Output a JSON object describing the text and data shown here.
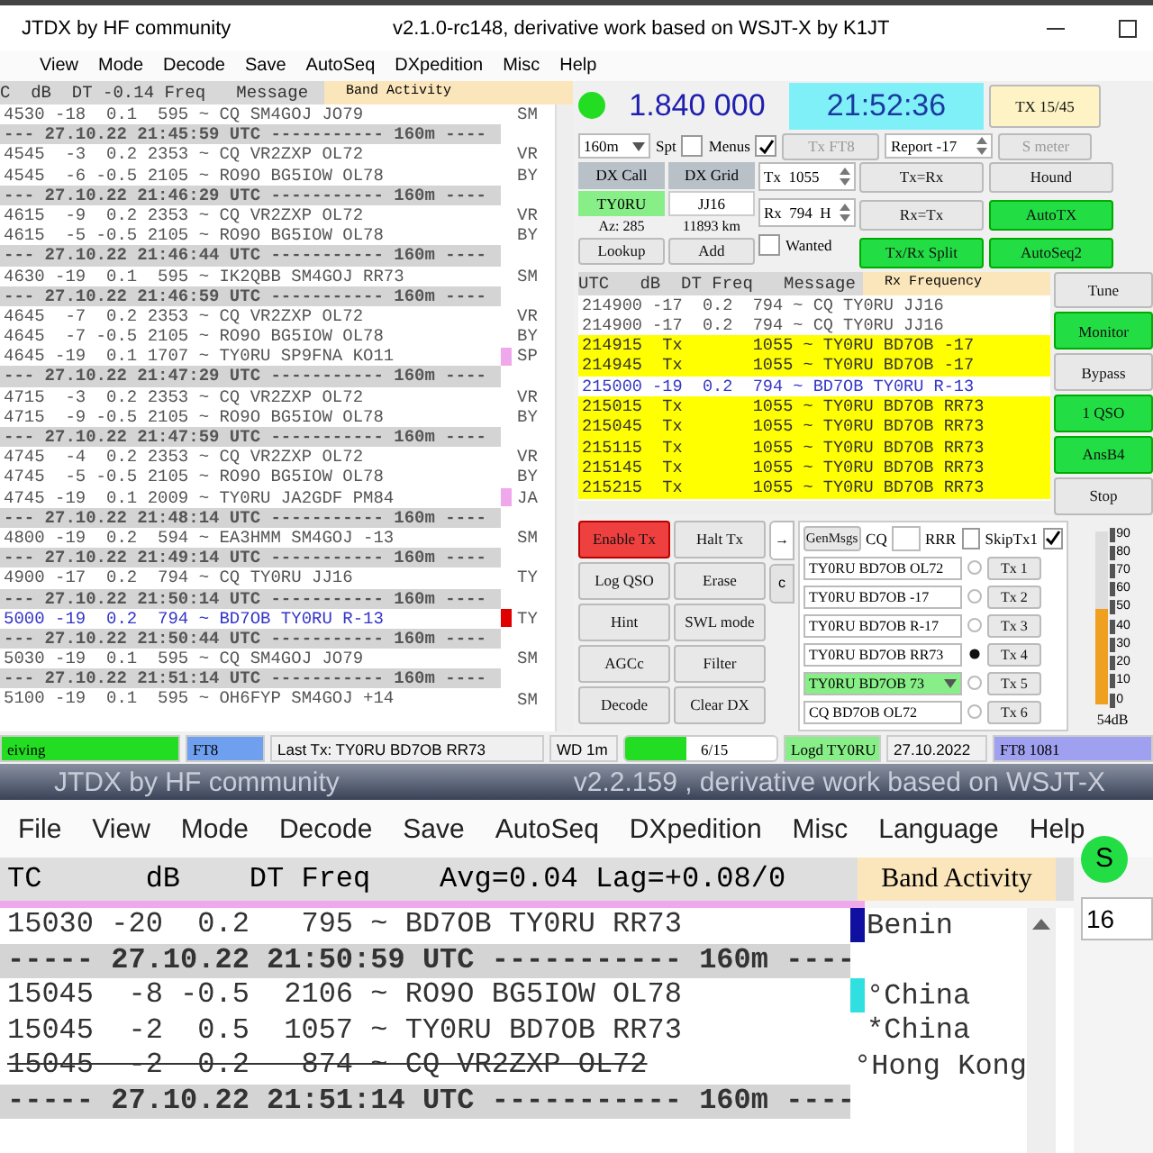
{
  "window": {
    "title": "JTDX  by HF community",
    "subtitle": "v2.1.0-rc148, derivative work based on WSJT-X by K1JT"
  },
  "menu": [
    "View",
    "Mode",
    "Decode",
    "Save",
    "AutoSeq",
    "DXpedition",
    "Misc",
    "Help"
  ],
  "band_activity": {
    "header": "C  dB  DT -0.14 Freq   Message",
    "tab": "Band Activity",
    "rows": [
      {
        "kind": "decode",
        "text": "4530 -18  0.1  595 ~ CQ SM4GOJ JO79",
        "country": "SM"
      },
      {
        "kind": "separator",
        "text": "--- 27.10.22 21:45:59 UTC ----------- 160m ----"
      },
      {
        "kind": "decode",
        "text": "4545  -3  0.2 2353 ~ CQ VR2ZXP OL72",
        "country": "VR"
      },
      {
        "kind": "decode",
        "text": "4545  -6 -0.5 2105 ~ RO9O BG5IOW OL78",
        "country": "BY"
      },
      {
        "kind": "separator",
        "text": "--- 27.10.22 21:46:29 UTC ----------- 160m ----"
      },
      {
        "kind": "decode",
        "text": "4615  -9  0.2 2353 ~ CQ VR2ZXP OL72",
        "country": "VR"
      },
      {
        "kind": "decode",
        "text": "4615  -5 -0.5 2105 ~ RO9O BG5IOW OL78",
        "country": "BY"
      },
      {
        "kind": "separator",
        "text": "--- 27.10.22 21:46:44 UTC ----------- 160m ----"
      },
      {
        "kind": "decode",
        "text": "4630 -19  0.1  595 ~ IK2QBB SM4GOJ RR73",
        "country": "SM"
      },
      {
        "kind": "separator",
        "text": "--- 27.10.22 21:46:59 UTC ----------- 160m ----"
      },
      {
        "kind": "decode",
        "text": "4645  -7  0.2 2353 ~ CQ VR2ZXP OL72",
        "country": "VR"
      },
      {
        "kind": "decode",
        "text": "4645  -7 -0.5 2105 ~ RO9O BG5IOW OL78",
        "country": "BY"
      },
      {
        "kind": "decode",
        "text": "4645 -19  0.1 1707 ~ TY0RU SP9FNA KO11",
        "country": "SP",
        "color": "#f0a8ec"
      },
      {
        "kind": "separator",
        "text": "--- 27.10.22 21:47:29 UTC ----------- 160m ----"
      },
      {
        "kind": "decode",
        "text": "4715  -3  0.2 2353 ~ CQ VR2ZXP OL72",
        "country": "VR"
      },
      {
        "kind": "decode",
        "text": "4715  -9 -0.5 2105 ~ RO9O BG5IOW OL78",
        "country": "BY"
      },
      {
        "kind": "separator",
        "text": "--- 27.10.22 21:47:59 UTC ----------- 160m ----"
      },
      {
        "kind": "decode",
        "text": "4745  -4  0.2 2353 ~ CQ VR2ZXP OL72",
        "country": "VR"
      },
      {
        "kind": "decode",
        "text": "4745  -5 -0.5 2105 ~ RO9O BG5IOW OL78",
        "country": "BY"
      },
      {
        "kind": "decode",
        "text": "4745 -19  0.1 2009 ~ TY0RU JA2GDF PM84",
        "country": "JA",
        "color": "#f0a8ec"
      },
      {
        "kind": "separator",
        "text": "--- 27.10.22 21:48:14 UTC ----------- 160m ----"
      },
      {
        "kind": "decode",
        "text": "4800 -19  0.2  594 ~ EA3HMM SM4GOJ -13",
        "country": "SM"
      },
      {
        "kind": "separator",
        "text": "--- 27.10.22 21:49:14 UTC ----------- 160m ----"
      },
      {
        "kind": "decode",
        "text": "4900 -17  0.2  794 ~ CQ TY0RU JJ16",
        "country": "TY"
      },
      {
        "kind": "separator",
        "text": "--- 27.10.22 21:50:14 UTC ----------- 160m ----"
      },
      {
        "kind": "decode",
        "text": "5000 -19  0.2  794 ~ BD7OB TY0RU R-13",
        "country": "TY",
        "color": "#e00000",
        "addressed": true
      },
      {
        "kind": "separator",
        "text": "--- 27.10.22 21:50:44 UTC ----------- 160m ----"
      },
      {
        "kind": "decode",
        "text": "5030 -19  0.1  595 ~ CQ SM4GOJ JO79",
        "country": "SM"
      },
      {
        "kind": "separator",
        "text": "--- 27.10.22 21:51:14 UTC ----------- 160m ----"
      },
      {
        "kind": "decode",
        "text": "5100 -19  0.1  595 ~ OH6FYP SM4GOJ +14",
        "country": "SM"
      }
    ]
  },
  "dial": {
    "led_on": true,
    "frequency": "1.840 000",
    "clock": "21:52:36",
    "tx_period": "TX 15/45"
  },
  "settings": {
    "band": "160m",
    "spt": {
      "label": "Spt",
      "checked": false
    },
    "menus": {
      "label": "Menus",
      "checked": true
    },
    "tx_mode": {
      "label": "Tx FT8",
      "disabled": true
    },
    "report": "Report -17",
    "s_meter": {
      "label": "S meter",
      "disabled": true
    }
  },
  "dx": {
    "call_label": "DX Call",
    "grid_label": "DX Grid",
    "call": "TY0RU",
    "grid": "JJ16",
    "azimuth": "Az: 285",
    "distance": "11893 km",
    "lookup": "Lookup",
    "add": "Add",
    "wanted": {
      "label": "Wanted",
      "checked": false
    }
  },
  "tx_freq": "Tx  1055",
  "rx_freq": "Rx  794  H",
  "toggles": [
    {
      "label": "Tx=Rx",
      "on": false
    },
    {
      "label": "Hound",
      "on": false
    },
    {
      "label": "Rx=Tx",
      "on": false
    },
    {
      "label": "AutoTX",
      "on": true
    },
    {
      "label": "Tx/Rx Split",
      "on": true
    },
    {
      "label": "AutoSeq2",
      "on": true
    }
  ],
  "rx_frequency": {
    "header": "UTC   dB  DT Freq   Message",
    "tab": "Rx Frequency",
    "rows": [
      {
        "kind": "rx",
        "text": "214900 -17  0.2  794 ~ CQ TY0RU JJ16"
      },
      {
        "kind": "rx",
        "text": "214900 -17  0.2  794 ~ CQ TY0RU JJ16"
      },
      {
        "kind": "tx",
        "text": "214915  Tx       1055 ~ TY0RU BD7OB -17"
      },
      {
        "kind": "tx",
        "text": "214945  Tx       1055 ~ TY0RU BD7OB -17"
      },
      {
        "kind": "rx",
        "text": "215000 -19  0.2  794 ~ BD7OB TY0RU R-13",
        "addressed": true
      },
      {
        "kind": "tx",
        "text": "215015  Tx       1055 ~ TY0RU BD7OB RR73"
      },
      {
        "kind": "tx",
        "text": "215045  Tx       1055 ~ TY0RU BD7OB RR73"
      },
      {
        "kind": "tx",
        "text": "215115  Tx       1055 ~ TY0RU BD7OB RR73"
      },
      {
        "kind": "tx",
        "text": "215145  Tx       1055 ~ TY0RU BD7OB RR73"
      },
      {
        "kind": "tx",
        "text": "215215  Tx       1055 ~ TY0RU BD7OB RR73"
      }
    ]
  },
  "side_buttons": [
    {
      "label": "Tune",
      "on": false
    },
    {
      "label": "Monitor",
      "on": true
    },
    {
      "label": "Bypass",
      "on": false
    },
    {
      "label": "1 QSO",
      "on": true
    },
    {
      "label": "AnsB4",
      "on": true
    },
    {
      "label": "Stop",
      "on": false
    }
  ],
  "action_buttons": [
    {
      "label": "Enable Tx",
      "on": true
    },
    {
      "label": "Halt Tx",
      "on": false
    },
    {
      "label": "Log QSO",
      "on": false
    },
    {
      "label": "Erase",
      "on": false
    },
    {
      "label": "Hint",
      "on": false
    },
    {
      "label": "SWL mode",
      "on": false
    },
    {
      "label": "AGCc",
      "on": false
    },
    {
      "label": "Filter",
      "on": false
    },
    {
      "label": "Decode",
      "on": false
    },
    {
      "label": "Clear DX",
      "on": false
    }
  ],
  "tabs": [
    {
      "label": "→",
      "selected": true
    },
    {
      "label": "c",
      "selected": false
    }
  ],
  "messages": {
    "gen": "GenMsgs",
    "cq_label": "CQ",
    "rrr": {
      "label": "RRR",
      "checked": false
    },
    "skip": {
      "label": "SkipTx1",
      "checked": true
    },
    "rows": [
      {
        "kind": "field",
        "text": "TY0RU BD7OB OL72",
        "selected": false,
        "button": "Tx 1"
      },
      {
        "kind": "field",
        "text": "TY0RU BD7OB -17",
        "selected": false,
        "button": "Tx 2"
      },
      {
        "kind": "field",
        "text": "TY0RU BD7OB R-17",
        "selected": false,
        "button": "Tx 3"
      },
      {
        "kind": "field",
        "text": "TY0RU BD7OB RR73",
        "selected": true,
        "button": "Tx 4"
      },
      {
        "kind": "combo",
        "text": "TY0RU BD7OB 73",
        "selected": false,
        "button": "Tx 5"
      },
      {
        "kind": "field",
        "text": "CQ BD7OB OL72",
        "selected": false,
        "button": "Tx 6"
      }
    ]
  },
  "meter": {
    "ticks": [
      "90",
      "80",
      "70",
      "60",
      "50",
      "40",
      "30",
      "20",
      "10",
      "0"
    ],
    "level": 0.55,
    "reading": "54dB"
  },
  "status_bar": [
    {
      "kind": "text",
      "text": "eiving",
      "color": "#22dd22"
    },
    {
      "kind": "text",
      "text": "FT8",
      "color": "#6fa0f0"
    },
    {
      "kind": "text",
      "text": "Last Tx: TY0RU BD7OB RR73"
    },
    {
      "kind": "text",
      "text": "WD 1m"
    },
    {
      "kind": "progress",
      "text": "6/15",
      "level": 0.4
    },
    {
      "kind": "text",
      "text": "Logd TY0RU",
      "color": "#88ee88"
    },
    {
      "kind": "text",
      "text": "27.10.2022"
    },
    {
      "kind": "text",
      "text": "FT8  1081",
      "color": "#a0a0f0"
    }
  ],
  "zoomed": {
    "title": "JTDX  by HF community",
    "subtitle": "v2.2.159 , derivative work based on WSJT-X",
    "menu": [
      "File",
      "View",
      "Mode",
      "Decode",
      "Save",
      "AutoSeq",
      "DXpedition",
      "Misc",
      "Language",
      "Help"
    ],
    "header": "TC      dB    DT Freq    Avg=0.04 Lag=+0.08/0",
    "tab": "Band Activity",
    "led_label": "S",
    "band": "16",
    "rows": [
      {
        "kind": "decode",
        "text": "15030 -20  0.2   795 ~ BD7OB TY0RU RR73",
        "country": "Benin",
        "color": "#1010a0"
      },
      {
        "kind": "separator",
        "text": "----- 27.10.22 21:50:59 UTC ----------- 160m ----"
      },
      {
        "kind": "decode",
        "text": "15045  -8 -0.5  2106 ~ RO9O BG5IOW OL78",
        "country": "°China",
        "color": "#30e0e0"
      },
      {
        "kind": "decode",
        "text": "15045  -2  0.5  1057 ~ TY0RU BD7OB RR73",
        "country": "*China"
      },
      {
        "kind": "decode",
        "text": "15045  -2  0.2   874 ~ CQ VR2ZXP OL72",
        "country": "°Hong Kong",
        "struck": true
      },
      {
        "kind": "separator",
        "text": "----- 27.10.22 21:51:14 UTC ----------- 160m ----"
      }
    ]
  }
}
